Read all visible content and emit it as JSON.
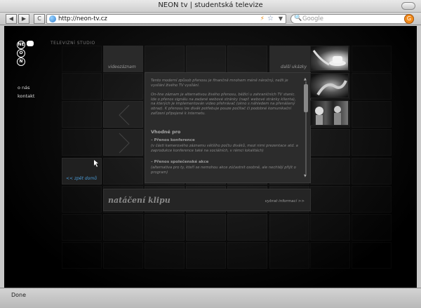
{
  "browser": {
    "window_title": "NEON tv | studentská televize",
    "url": "http://neon-tv.cz",
    "search_placeholder": "Google",
    "status": "Done",
    "back_glyph": "◀",
    "forward_glyph": "▶",
    "reload_glyph": "C",
    "rss_glyph": "⚡",
    "star_glyph": "☆",
    "drop_glyph": "▼",
    "search_glyph": "🔍",
    "g_glyph": "G"
  },
  "site": {
    "logo_letters": [
      "NE",
      "O",
      "N"
    ],
    "studio_label": "TELEVIZNÍ STUDIO",
    "nav": [
      "o nás",
      "kontakt"
    ],
    "tiles": {
      "videozaznam": "videozáznam",
      "dalsi_ukazky": "další ukázky",
      "zpet_domu": "<< zpět domů"
    },
    "panel": {
      "intro": "Tento moderní způsob přenosu je finančně mnohem méně náročný, nežli je vysílání živého TV vysílání.",
      "detail": "On-line záznam je alternativou živého přenosu, běžící u zahraničních TV stanic. Ide o přenos signálu na zadané webové stránky (např. webové stránky klienta), na kterých je implementován video přehrávač (okno s náhledem na přenášený obraz). K přenosu lze divák potřebuje pouze počítač či podobné komunikační zařízení připojené k internetu.",
      "heading": "Vhodné pro",
      "items": [
        {
          "title": "– Přenos konference",
          "desc": "(v části kamerového záznamu většího počtu diváků, mezi nimi prezentace atd. a zaprodukce konference také na sociálních, v rámci lokalitách)"
        },
        {
          "title": "– Přenos společenské akce",
          "desc": "(alternativa pro ty, kteří se nemohou akce zúčastnit osobně, ale nechtějí přijít o program)"
        }
      ]
    },
    "bottom": {
      "title": "natáčení klipu",
      "more": "vybrat informací >>"
    },
    "icons": {
      "logo": "neon-logo-icon",
      "arrow_left": "chevron-left-icon",
      "arrow_right": "chevron-right-icon",
      "pointer": "cursor-icon"
    }
  }
}
